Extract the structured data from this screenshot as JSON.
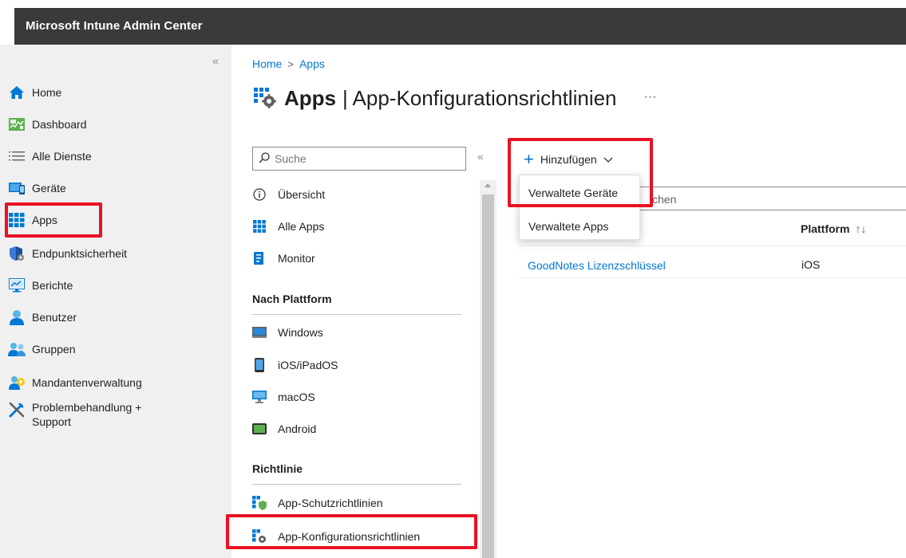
{
  "app": {
    "title": "Microsoft Intune Admin Center"
  },
  "leftnav": {
    "collapse_glyph": "«",
    "items": [
      {
        "label": "Home",
        "icon": "home-icon"
      },
      {
        "label": "Dashboard",
        "icon": "dashboard-icon"
      },
      {
        "label": "Alle Dienste",
        "icon": "list-icon"
      },
      {
        "label": "Geräte",
        "icon": "devices-icon"
      },
      {
        "label": "Apps",
        "icon": "apps-grid-icon"
      },
      {
        "label": "Endpunktsicherheit",
        "icon": "shield-icon"
      },
      {
        "label": "Berichte",
        "icon": "reports-icon"
      },
      {
        "label": "Benutzer",
        "icon": "user-icon"
      },
      {
        "label": "Gruppen",
        "icon": "groups-icon"
      },
      {
        "label": "Mandantenverwaltung",
        "icon": "tenant-icon"
      },
      {
        "label": "Problembehandlung + Support",
        "icon": "tools-icon"
      }
    ]
  },
  "breadcrumb": {
    "home": "Home",
    "sep": ">",
    "current": "Apps"
  },
  "page": {
    "title_strong": "Apps",
    "title_rest": "| App-Konfigurationsrichtlinien",
    "more": "···"
  },
  "subnav": {
    "search_placeholder": "Suche",
    "collapse_glyph": "«",
    "items_top": [
      {
        "label": "Übersicht",
        "icon": "info-icon"
      },
      {
        "label": "Alle Apps",
        "icon": "apps-grid-icon"
      },
      {
        "label": "Monitor",
        "icon": "monitor-icon"
      }
    ],
    "section_platform": "Nach Plattform",
    "items_platform": [
      {
        "label": "Windows",
        "icon": "windows-device-icon"
      },
      {
        "label": "iOS/iPadOS",
        "icon": "phone-icon"
      },
      {
        "label": "macOS",
        "icon": "desktop-icon"
      },
      {
        "label": "Android",
        "icon": "android-device-icon"
      }
    ],
    "section_policy": "Richtlinie",
    "items_policy": [
      {
        "label": "App-Schutzrichtlinien",
        "icon": "app-protection-icon"
      },
      {
        "label": "App-Konfigurationsrichtlinien",
        "icon": "app-config-icon"
      }
    ]
  },
  "toolbar": {
    "add_label": "Hinzufügen"
  },
  "dropdown": {
    "options": [
      "Verwaltete Geräte",
      "Verwaltete Apps"
    ]
  },
  "filter": {
    "visible_text": "chen"
  },
  "table": {
    "columns": [
      "Plattform"
    ],
    "sort_glyph": "↑↓",
    "rows": [
      {
        "name": "GoodNotes Lizenzschlüssel",
        "platform": "iOS"
      }
    ]
  },
  "colors": {
    "accent": "#0078d4",
    "topbar": "#3b3a39",
    "highlight": "#e81123",
    "nav_bg": "#f0f0f0"
  }
}
